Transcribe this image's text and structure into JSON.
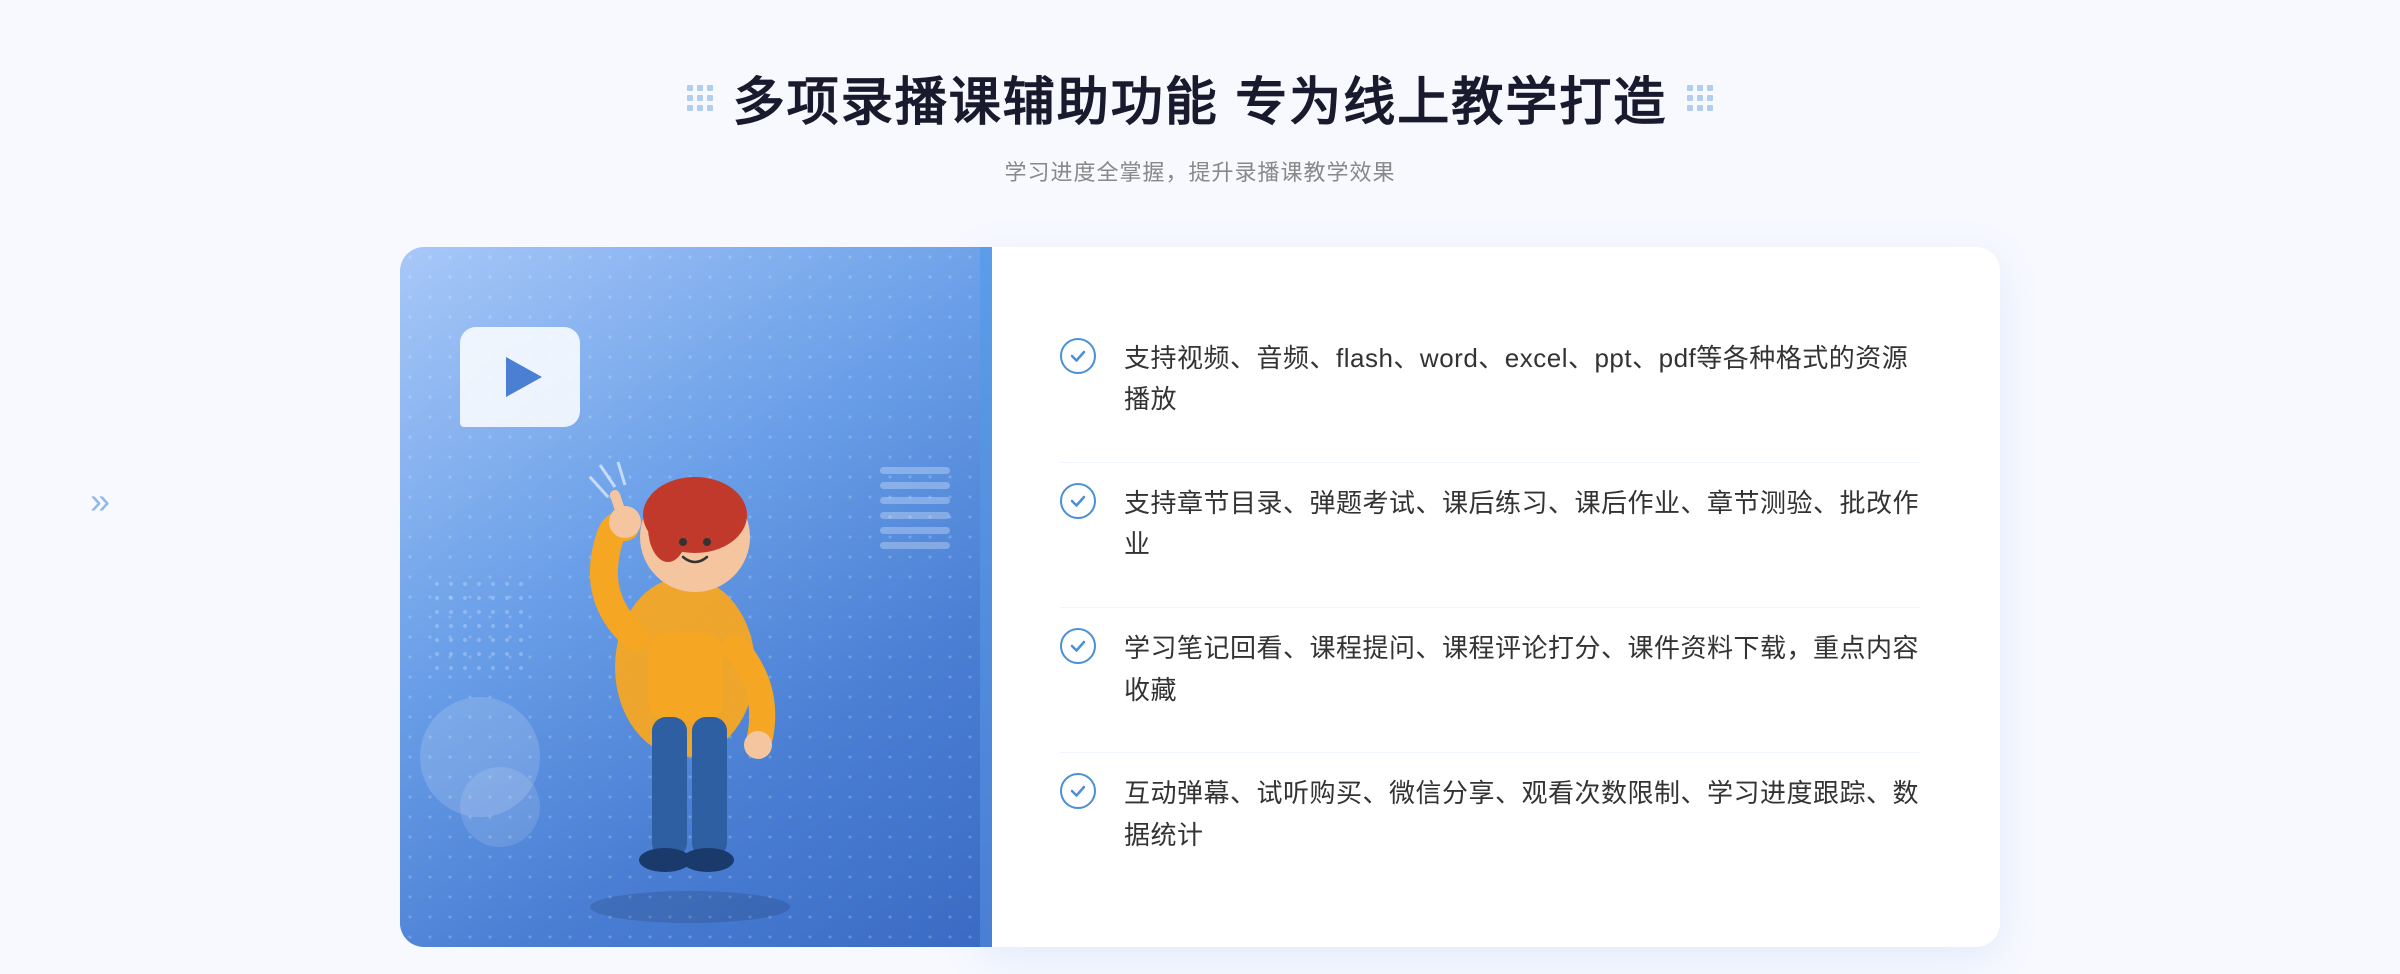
{
  "header": {
    "title": "多项录播课辅助功能 专为线上教学打造",
    "subtitle": "学习进度全掌握，提升录播课教学效果",
    "grid_icon_left": "grid-dots-icon",
    "grid_icon_right": "grid-dots-icon"
  },
  "features": [
    {
      "id": 1,
      "text": "支持视频、音频、flash、word、excel、ppt、pdf等各种格式的资源播放"
    },
    {
      "id": 2,
      "text": "支持章节目录、弹题考试、课后练习、课后作业、章节测验、批改作业"
    },
    {
      "id": 3,
      "text": "学习笔记回看、课程提问、课程评论打分、课件资料下载，重点内容收藏"
    },
    {
      "id": 4,
      "text": "互动弹幕、试听购买、微信分享、观看次数限制、学习进度跟踪、数据统计"
    }
  ],
  "decorations": {
    "arrows_left": "»",
    "play_button_label": "play-button"
  },
  "colors": {
    "primary_blue": "#4a7fd4",
    "light_blue": "#a8c8f8",
    "accent": "#4a90d9",
    "text_dark": "#1a1a2e",
    "text_gray": "#888888",
    "text_body": "#333333"
  }
}
